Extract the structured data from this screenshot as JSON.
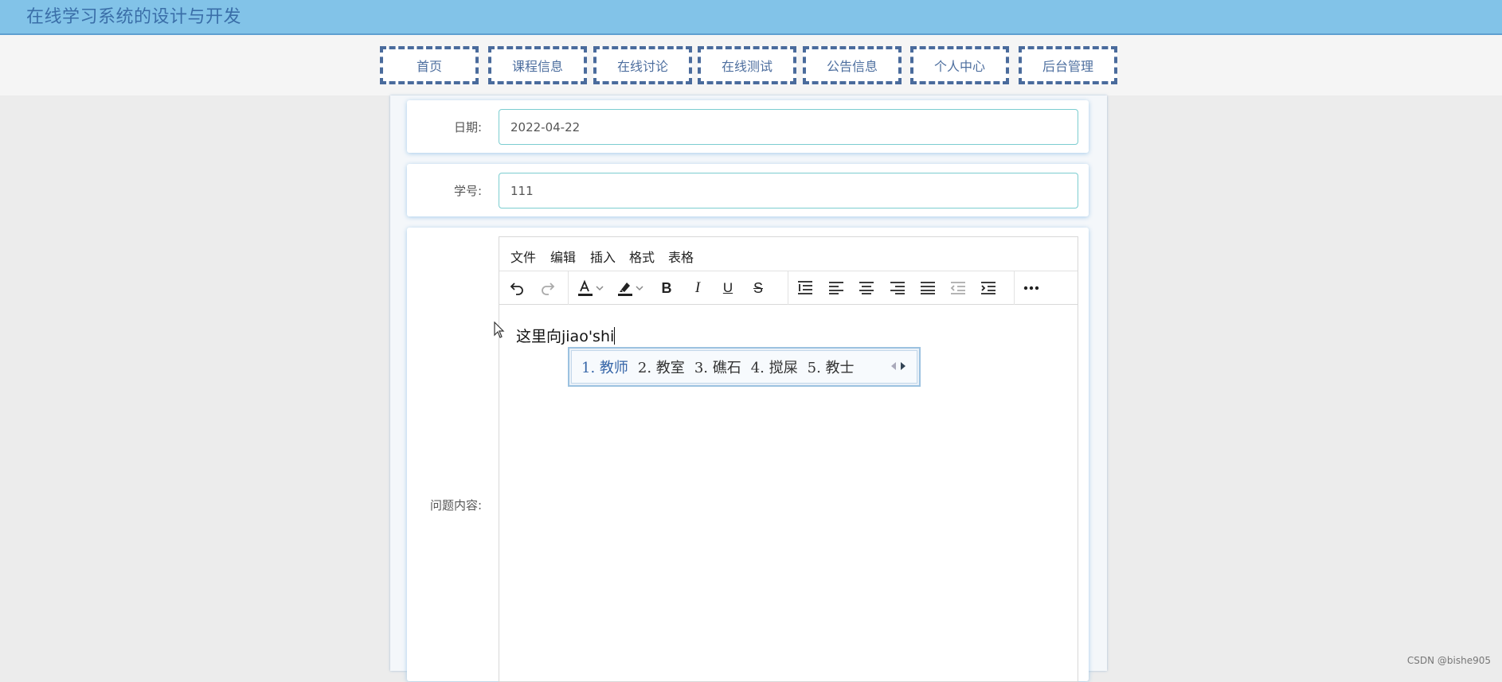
{
  "header": {
    "title": "在线学习系统的设计与开发"
  },
  "nav": {
    "items": [
      {
        "label": "首页"
      },
      {
        "label": "课程信息"
      },
      {
        "label": "在线讨论"
      },
      {
        "label": "在线测试"
      },
      {
        "label": "公告信息"
      },
      {
        "label": "个人中心"
      },
      {
        "label": "后台管理"
      }
    ]
  },
  "form": {
    "date_label": "日期:",
    "date_value": "2022-04-22",
    "student_id_label": "学号:",
    "student_id_value": "111",
    "question_label": "问题内容:"
  },
  "editor": {
    "menus": [
      "文件",
      "编辑",
      "插入",
      "格式",
      "表格"
    ],
    "toolbar_icons": [
      "undo-icon",
      "redo-icon",
      "font-color-icon",
      "highlight-icon",
      "bold-icon",
      "italic-icon",
      "underline-icon",
      "strikethrough-icon",
      "line-height-icon",
      "align-left-icon",
      "align-center-icon",
      "align-right-icon",
      "align-justify-icon",
      "outdent-icon",
      "indent-icon",
      "more-icon"
    ],
    "content_text": "这里向jiao'shi"
  },
  "ime": {
    "candidates": [
      "1. 教师",
      "2. 教室",
      "3. 礁石",
      "4. 搅屎",
      "5. 教士"
    ]
  },
  "watermark": "CSDN @bishe905",
  "colors": {
    "header_bg": "#82c3e8",
    "nav_border": "#4a6b9c",
    "input_border": "#7ccdd0"
  }
}
